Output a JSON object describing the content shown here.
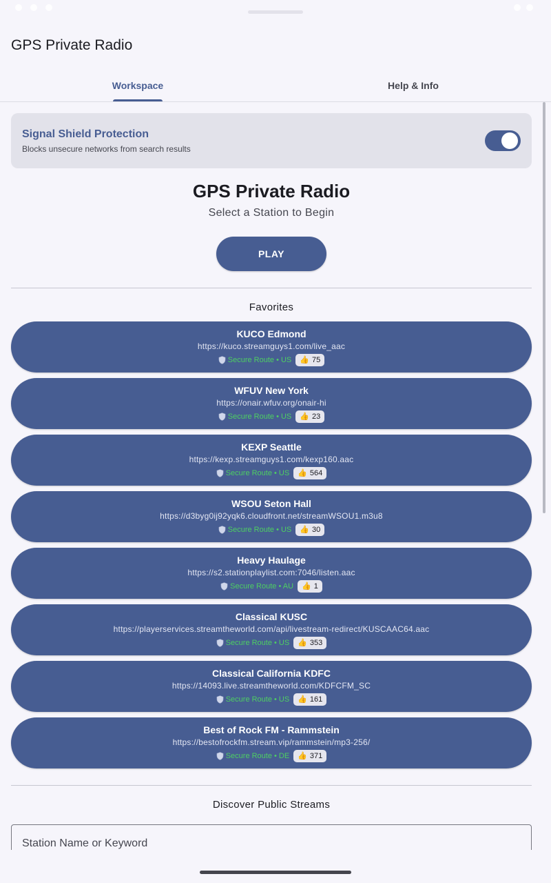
{
  "app": {
    "title": "GPS Private Radio"
  },
  "tabs": [
    {
      "label": "Workspace",
      "active": true
    },
    {
      "label": "Help & Info",
      "active": false
    }
  ],
  "shield": {
    "title": "Signal Shield Protection",
    "subtitle": "Blocks unsecure networks from search results",
    "enabled": true
  },
  "hero": {
    "title": "GPS Private Radio",
    "subtitle": "Select a Station to Begin",
    "play_label": "PLAY"
  },
  "favorites": {
    "title": "Favorites",
    "stations": [
      {
        "name": "KUCO Edmond",
        "url": "https://kuco.streamguys1.com/live_aac",
        "route": "Secure Route • US",
        "votes": "75"
      },
      {
        "name": "WFUV New York",
        "url": "https://onair.wfuv.org/onair-hi",
        "route": "Secure Route • US",
        "votes": "23"
      },
      {
        "name": "KEXP Seattle",
        "url": "https://kexp.streamguys1.com/kexp160.aac",
        "route": "Secure Route • US",
        "votes": "564"
      },
      {
        "name": "WSOU Seton Hall",
        "url": "https://d3byg0ij92yqk6.cloudfront.net/streamWSOU1.m3u8",
        "route": "Secure Route • US",
        "votes": "30"
      },
      {
        "name": "Heavy Haulage",
        "url": "https://s2.stationplaylist.com:7046/listen.aac",
        "route": "Secure Route • AU",
        "votes": "1"
      },
      {
        "name": "Classical KUSC",
        "url": "https://playerservices.streamtheworld.com/api/livestream-redirect/KUSCAAC64.aac",
        "route": "Secure Route • US",
        "votes": "353"
      },
      {
        "name": "Classical California KDFC",
        "url": "https://14093.live.streamtheworld.com/KDFCFM_SC",
        "route": "Secure Route • US",
        "votes": "161"
      },
      {
        "name": "Best of Rock FM - Rammstein",
        "url": "https://bestofrockfm.stream.vip/rammstein/mp3-256/",
        "route": "Secure Route • DE",
        "votes": "371"
      }
    ]
  },
  "discover": {
    "title": "Discover Public Streams",
    "search_placeholder": "Station Name or Keyword"
  },
  "icons": {
    "route_icon": "shield-icon",
    "vote_icon": "thumbs-up-icon"
  },
  "colors": {
    "primary": "#475d92",
    "secure_green": "#4ecf62",
    "background": "#f6f5fb"
  }
}
